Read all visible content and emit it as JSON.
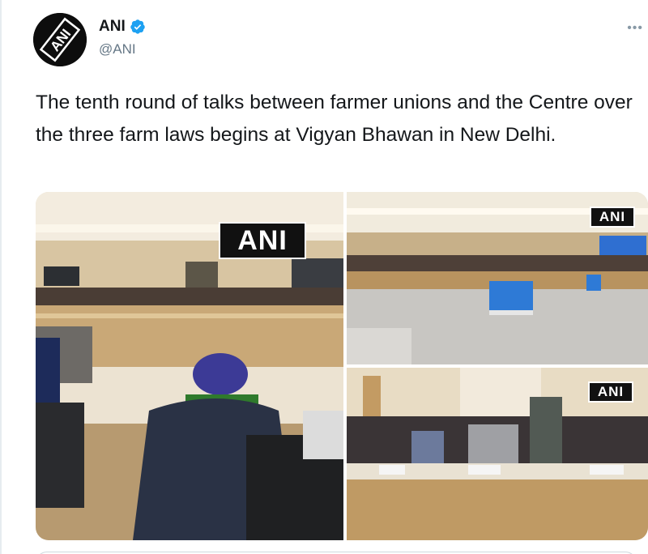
{
  "tweet": {
    "author": {
      "display_name": "ANI",
      "handle": "@ANI",
      "verified": true,
      "avatar_logo": "ANI"
    },
    "text": "The tenth round of talks between farmer unions and the Centre over the three farm laws begins at Vigyan Bhawan in New Delhi.",
    "more_icon": "more-horizontal-icon",
    "colors": {
      "verified_badge": "#1da1f2",
      "text": "#14171a",
      "handle": "#657786"
    },
    "media": [
      {
        "watermark": "ANI"
      },
      {
        "watermark": "ANI"
      },
      {
        "watermark": "ANI"
      }
    ]
  }
}
